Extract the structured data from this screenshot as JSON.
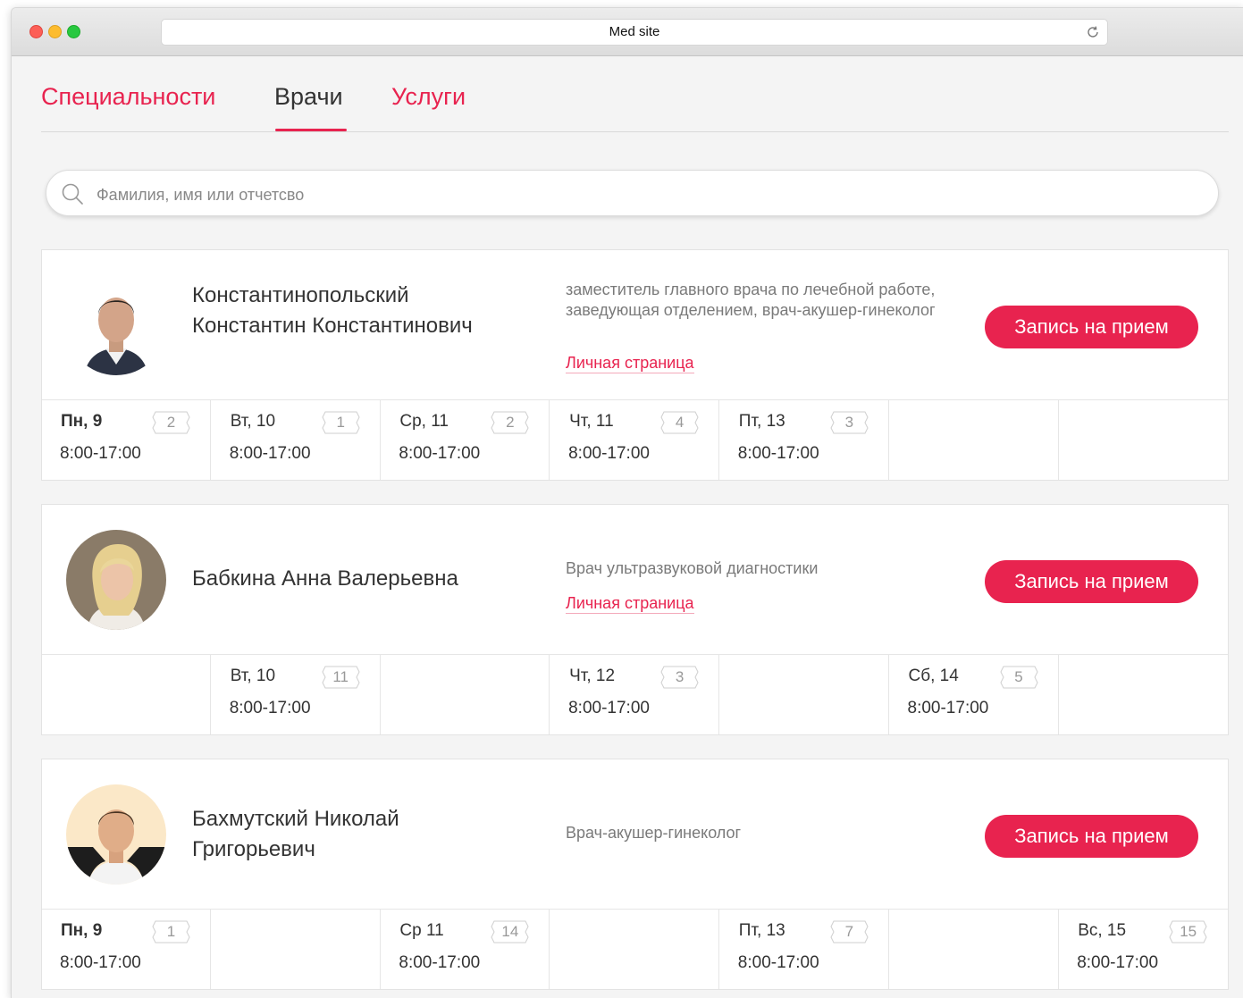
{
  "browser": {
    "url_title": "Med site"
  },
  "nav": {
    "tabs": [
      {
        "label": "Специальности",
        "active": false
      },
      {
        "label": "Врачи",
        "active": true
      },
      {
        "label": "Услуги",
        "active": false
      }
    ]
  },
  "search": {
    "placeholder": "Фамилия, имя или отчетсво",
    "value": ""
  },
  "colors": {
    "accent": "#e8234f"
  },
  "doctors": [
    {
      "name": "Константинопольский Константин Константинович",
      "role": "заместитель главного врача по лечебной работе, заведующая отделением, врач-акушер-гинеколог",
      "profile_link": "Личная страница",
      "book_label": "Запись на прием",
      "schedule": [
        {
          "day": "Пн, 9",
          "time": "8:00-17:00",
          "slots": "2",
          "bold": true
        },
        {
          "day": "Вт, 10",
          "time": "8:00-17:00",
          "slots": "1"
        },
        {
          "day": "Ср, 11",
          "time": "8:00-17:00",
          "slots": "2"
        },
        {
          "day": "Чт, 11",
          "time": "8:00-17:00",
          "slots": "4"
        },
        {
          "day": "Пт, 13",
          "time": "8:00-17:00",
          "slots": "3"
        },
        null,
        null
      ]
    },
    {
      "name": "Бабкина Анна Валерьевна",
      "role": "Врач ультразвуковой диагностики",
      "profile_link": "Личная страница",
      "book_label": "Запись на прием",
      "schedule": [
        null,
        {
          "day": "Вт, 10",
          "time": "8:00-17:00",
          "slots": "11"
        },
        null,
        {
          "day": "Чт, 12",
          "time": "8:00-17:00",
          "slots": "3"
        },
        null,
        {
          "day": "Сб, 14",
          "time": "8:00-17:00",
          "slots": "5"
        },
        null
      ]
    },
    {
      "name": "Бахмутский Николай Григорьевич",
      "role": "Врач-акушер-гинеколог",
      "profile_link": "",
      "book_label": "Запись на прием",
      "schedule": [
        {
          "day": "Пн, 9",
          "time": "8:00-17:00",
          "slots": "1",
          "bold": true
        },
        null,
        {
          "day": "Ср 11",
          "time": "8:00-17:00",
          "slots": "14"
        },
        null,
        {
          "day": "Пт, 13",
          "time": "8:00-17:00",
          "slots": "7"
        },
        null,
        {
          "day": "Вс, 15",
          "time": "8:00-17:00",
          "slots": "15"
        }
      ]
    }
  ]
}
